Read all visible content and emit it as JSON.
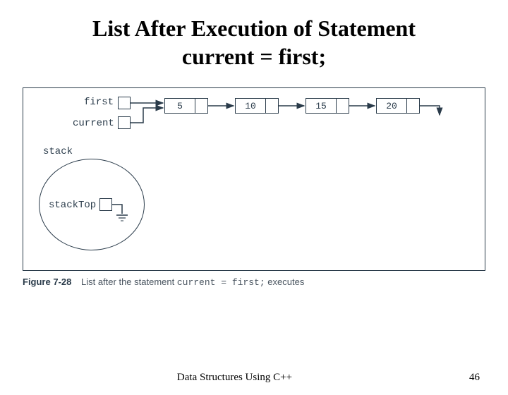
{
  "title_line1": "List After Execution of Statement",
  "title_line2": "current = first;",
  "pointers": {
    "first": "first",
    "current": "current",
    "stack": "stack",
    "stackTop": "stackTop"
  },
  "nodes": [
    "5",
    "10",
    "15",
    "20"
  ],
  "caption": {
    "fignum": "Figure 7-28",
    "text_before": "List after the statement ",
    "code": "current = first;",
    "text_after": " executes"
  },
  "footer": {
    "source": "Data Structures Using C++",
    "page": "46"
  }
}
